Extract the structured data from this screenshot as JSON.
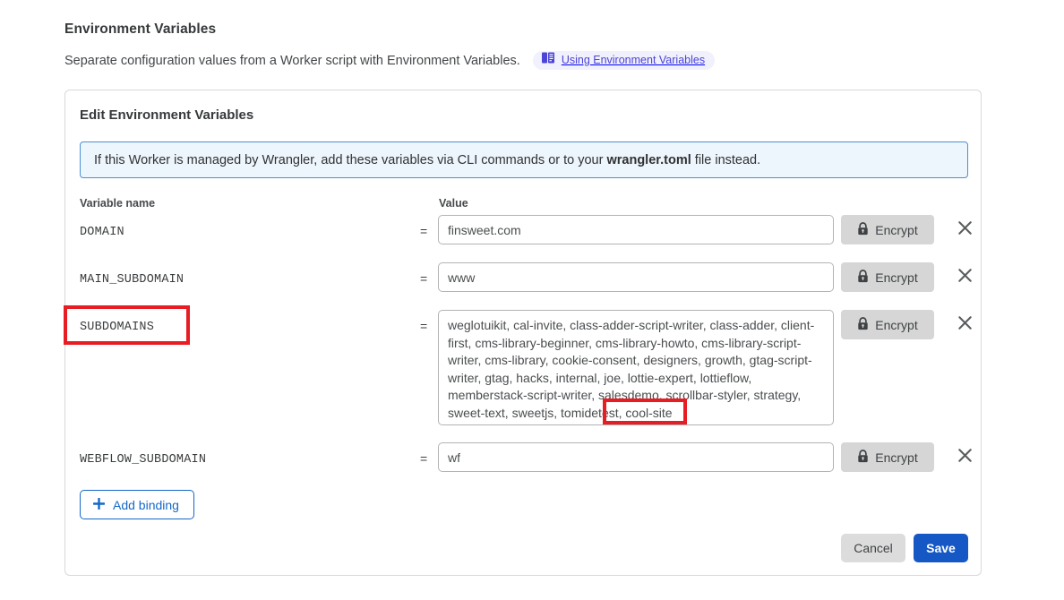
{
  "page": {
    "section_title": "Environment Variables",
    "section_description": "Separate configuration values from a Worker script with Environment Variables.",
    "doc_link_label": "Using Environment Variables",
    "doc_link_icon": "book-icon"
  },
  "card": {
    "title": "Edit Environment Variables",
    "info_banner": {
      "text_before": "If this Worker is managed by Wrangler, add these variables via CLI commands or to your ",
      "bold": "wrangler.toml",
      "text_after": " file instead."
    },
    "columns": {
      "name": "Variable name",
      "value": "Value"
    },
    "equals_sign": "=",
    "rows": [
      {
        "name": "DOMAIN",
        "value": "finsweet.com",
        "encrypt_label": "Encrypt",
        "encrypt_icon": "lock-icon",
        "remove_icon": "close-icon",
        "multiline": false
      },
      {
        "name": "MAIN_SUBDOMAIN",
        "value": "www",
        "encrypt_label": "Encrypt",
        "encrypt_icon": "lock-icon",
        "remove_icon": "close-icon",
        "multiline": false
      },
      {
        "name": "SUBDOMAINS",
        "value": "weglotuikit, cal-invite, class-adder-script-writer, class-adder, client-first, cms-library-beginner, cms-library-howto, cms-library-script-writer, cms-library, cookie-consent, designers, growth, gtag-script-writer, gtag, hacks, internal, joe, lottie-expert, lottieflow, memberstack-script-writer, salesdemo, scrollbar-styler, strategy, sweet-text, sweetjs, tomidetest, cool-site",
        "encrypt_label": "Encrypt",
        "encrypt_icon": "lock-icon",
        "remove_icon": "close-icon",
        "multiline": true
      },
      {
        "name": "WEBFLOW_SUBDOMAIN",
        "value": "wf",
        "encrypt_label": "Encrypt",
        "encrypt_icon": "lock-icon",
        "remove_icon": "close-icon",
        "multiline": false
      }
    ],
    "add_binding_label": "Add binding",
    "add_binding_icon": "plus-icon",
    "cancel_label": "Cancel",
    "save_label": "Save"
  },
  "annotations": [
    {
      "name": "subdomains-highlight",
      "color": "#e81c23"
    },
    {
      "name": "cool-site-highlight",
      "color": "#e81c23"
    }
  ],
  "colors": {
    "accent_blue": "#1457c5",
    "link_blue": "#1568c8",
    "banner_bg": "#eef6fd",
    "banner_border": "#4d8fd4",
    "pill_bg": "#f1f0fd",
    "pill_text": "#4b44d6",
    "annotation_red": "#e81c23",
    "button_gray": "#d6d6d6"
  }
}
